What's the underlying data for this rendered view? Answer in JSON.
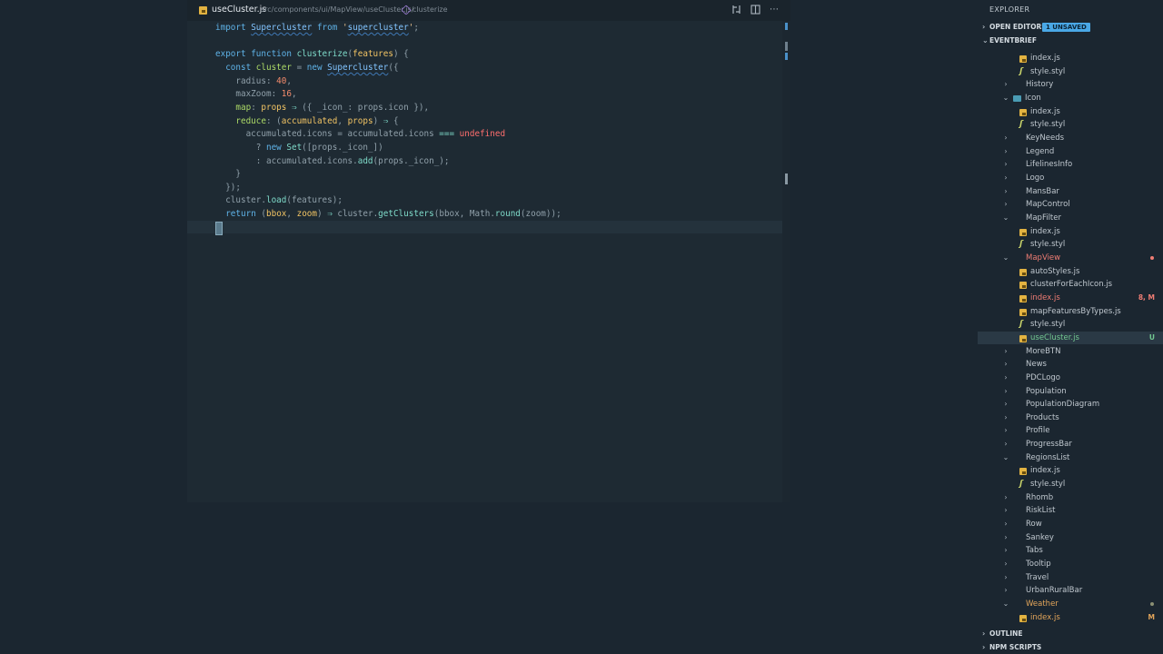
{
  "editor": {
    "tab": {
      "filename": "useCluster.js",
      "path": "src/components/ui/MapView/useCluster.js/",
      "symbol": "clusterize"
    }
  },
  "explorer": {
    "title": "EXPLORER",
    "open_editors": {
      "label": "OPEN EDITORS",
      "badge": "1 UNSAVED"
    },
    "project": {
      "label": "EVENTBRIEF"
    },
    "outline_label": "OUTLINE",
    "npm_label": "NPM SCRIPTS",
    "colors": {
      "modified": "#e2a55a",
      "untracked": "#73c991",
      "error": "#ef7d74",
      "default": "#c0c8cf"
    },
    "items": [
      {
        "label": "index.js",
        "type": "js",
        "depth": 2
      },
      {
        "label": "style.styl",
        "type": "styl",
        "depth": 2
      },
      {
        "label": "History",
        "type": "folder",
        "depth": 1
      },
      {
        "label": "Icon",
        "type": "folder-open",
        "depth": 1,
        "folder_icon": true
      },
      {
        "label": "index.js",
        "type": "js",
        "depth": 2
      },
      {
        "label": "style.styl",
        "type": "styl",
        "depth": 2
      },
      {
        "label": "KeyNeeds",
        "type": "folder",
        "depth": 1
      },
      {
        "label": "Legend",
        "type": "folder",
        "depth": 1
      },
      {
        "label": "LifelinesInfo",
        "type": "folder",
        "depth": 1
      },
      {
        "label": "Logo",
        "type": "folder",
        "depth": 1
      },
      {
        "label": "MansBar",
        "type": "folder",
        "depth": 1
      },
      {
        "label": "MapControl",
        "type": "folder",
        "depth": 1
      },
      {
        "label": "MapFilter",
        "type": "folder-open",
        "depth": 1
      },
      {
        "label": "index.js",
        "type": "js",
        "depth": 2
      },
      {
        "label": "style.styl",
        "type": "styl",
        "depth": 2
      },
      {
        "label": "MapView",
        "type": "folder-open",
        "depth": 1,
        "status": "error",
        "dot": true
      },
      {
        "label": "autoStyles.js",
        "type": "js",
        "depth": 2
      },
      {
        "label": "clusterForEachIcon.js",
        "type": "js",
        "depth": 2
      },
      {
        "label": "index.js",
        "type": "js",
        "depth": 2,
        "status": "error",
        "badge": "8, M"
      },
      {
        "label": "mapFeaturesByTypes.js",
        "type": "js",
        "depth": 2
      },
      {
        "label": "style.styl",
        "type": "styl",
        "depth": 2
      },
      {
        "label": "useCluster.js",
        "type": "js",
        "depth": 2,
        "status": "untracked",
        "badge": "U",
        "selected": true
      },
      {
        "label": "MoreBTN",
        "type": "folder",
        "depth": 1
      },
      {
        "label": "News",
        "type": "folder",
        "depth": 1
      },
      {
        "label": "PDCLogo",
        "type": "folder",
        "depth": 1
      },
      {
        "label": "Population",
        "type": "folder",
        "depth": 1
      },
      {
        "label": "PopulationDiagram",
        "type": "folder",
        "depth": 1
      },
      {
        "label": "Products",
        "type": "folder",
        "depth": 1
      },
      {
        "label": "Profile",
        "type": "folder",
        "depth": 1
      },
      {
        "label": "ProgressBar",
        "type": "folder",
        "depth": 1
      },
      {
        "label": "RegionsList",
        "type": "folder-open",
        "depth": 1
      },
      {
        "label": "index.js",
        "type": "js",
        "depth": 2
      },
      {
        "label": "style.styl",
        "type": "styl",
        "depth": 2
      },
      {
        "label": "Rhomb",
        "type": "folder",
        "depth": 1
      },
      {
        "label": "RiskList",
        "type": "folder",
        "depth": 1
      },
      {
        "label": "Row",
        "type": "folder",
        "depth": 1
      },
      {
        "label": "Sankey",
        "type": "folder",
        "depth": 1
      },
      {
        "label": "Tabs",
        "type": "folder",
        "depth": 1
      },
      {
        "label": "Tooltip",
        "type": "folder",
        "depth": 1
      },
      {
        "label": "Travel",
        "type": "folder",
        "depth": 1
      },
      {
        "label": "UrbanRuralBar",
        "type": "folder",
        "depth": 1
      },
      {
        "label": "Weather",
        "type": "folder-open",
        "depth": 1,
        "status": "modified",
        "dot": true,
        "dot_color": "#8a8f73"
      },
      {
        "label": "index.js",
        "type": "js",
        "depth": 2,
        "status": "modified",
        "badge": "M"
      }
    ]
  },
  "code_lines": [
    [
      [
        "kw",
        "import "
      ],
      [
        "cls",
        "Supercluster"
      ],
      [
        "kw",
        " from "
      ],
      [
        "str",
        "'"
      ],
      [
        "cls",
        "supercluster"
      ],
      [
        "str",
        "'"
      ],
      [
        "dim",
        ";"
      ]
    ],
    [],
    [
      [
        "kw",
        "export "
      ],
      [
        "kw",
        "function "
      ],
      [
        "fn",
        "clusterize"
      ],
      [
        "dim",
        "("
      ],
      [
        "param",
        "features"
      ],
      [
        "dim",
        ") {"
      ]
    ],
    [
      [
        "dim",
        "  "
      ],
      [
        "kw",
        "const "
      ],
      [
        "prop",
        "cluster"
      ],
      [
        "dim",
        " = "
      ],
      [
        "kw",
        "new "
      ],
      [
        "cls",
        "Supercluster"
      ],
      [
        "dim",
        "({"
      ]
    ],
    [
      [
        "dim",
        "    radius: "
      ],
      [
        "num",
        "40"
      ],
      [
        "dim",
        ","
      ]
    ],
    [
      [
        "dim",
        "    maxZoom: "
      ],
      [
        "num",
        "16"
      ],
      [
        "dim",
        ","
      ]
    ],
    [
      [
        "dim",
        "    "
      ],
      [
        "prop",
        "map"
      ],
      [
        "dim",
        ": "
      ],
      [
        "param",
        "props"
      ],
      [
        "op",
        " ⇒ "
      ],
      [
        "dim",
        "({ _icon_: props.icon }),"
      ]
    ],
    [
      [
        "dim",
        "    "
      ],
      [
        "prop",
        "reduce"
      ],
      [
        "dim",
        ": ("
      ],
      [
        "param",
        "accumulated"
      ],
      [
        "dim",
        ", "
      ],
      [
        "param",
        "props"
      ],
      [
        "dim",
        ")"
      ],
      [
        "op",
        " ⇒ "
      ],
      [
        "dim",
        "{"
      ]
    ],
    [
      [
        "dim",
        "      accumulated.icons = accumulated.icons "
      ],
      [
        "op",
        "==="
      ],
      [
        "undef",
        " undefined"
      ]
    ],
    [
      [
        "dim",
        "        ? "
      ],
      [
        "kw",
        "new "
      ],
      [
        "fn",
        "Set"
      ],
      [
        "dim",
        "([props._icon_])"
      ]
    ],
    [
      [
        "dim",
        "        : accumulated.icons."
      ],
      [
        "fn",
        "add"
      ],
      [
        "dim",
        "(props._icon_);"
      ]
    ],
    [
      [
        "dim",
        "    }"
      ]
    ],
    [
      [
        "dim",
        "  });"
      ]
    ],
    [
      [
        "dim",
        "  cluster."
      ],
      [
        "fn",
        "load"
      ],
      [
        "dim",
        "(features);"
      ]
    ],
    [
      [
        "dim",
        "  "
      ],
      [
        "kw",
        "return "
      ],
      [
        "dim",
        "("
      ],
      [
        "param",
        "bbox"
      ],
      [
        "dim",
        ", "
      ],
      [
        "param",
        "zoom"
      ],
      [
        "dim",
        ")"
      ],
      [
        "op",
        " ⇒ "
      ],
      [
        "dim",
        "cluster."
      ],
      [
        "fn",
        "getClusters"
      ],
      [
        "dim",
        "(bbox, Math."
      ],
      [
        "fn",
        "round"
      ],
      [
        "dim",
        "(zoom));"
      ]
    ],
    [
      [
        "dim",
        "}"
      ]
    ]
  ]
}
